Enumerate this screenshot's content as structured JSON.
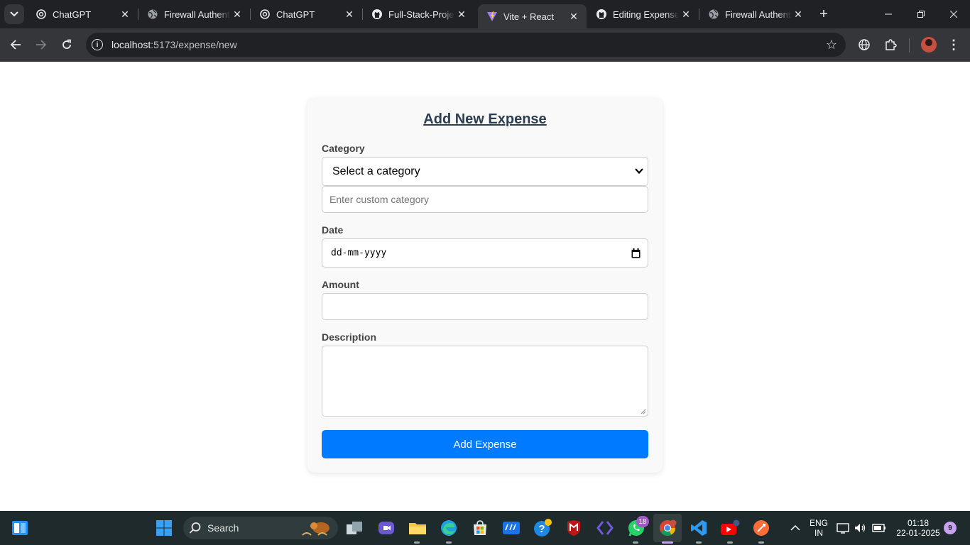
{
  "browser": {
    "tabs": [
      {
        "title": "ChatGPT",
        "icon": "chatgpt-icon",
        "active": false
      },
      {
        "title": "Firewall Authentication",
        "icon": "globe-icon",
        "active": false
      },
      {
        "title": "ChatGPT",
        "icon": "chatgpt-icon",
        "active": false
      },
      {
        "title": "Full-Stack-Project",
        "icon": "github-icon",
        "active": false
      },
      {
        "title": "Vite + React",
        "icon": "vite-icon",
        "active": true
      },
      {
        "title": "Editing Expense",
        "icon": "github-icon",
        "active": false
      },
      {
        "title": "Firewall Authentication",
        "icon": "globe-icon",
        "active": false
      }
    ],
    "address": {
      "host": "localhost",
      "path": ":5173/expense/new"
    }
  },
  "form": {
    "title": "Add New Expense",
    "category": {
      "label": "Category",
      "selected": "Select a category",
      "custom_placeholder": "Enter custom category"
    },
    "date": {
      "label": "Date",
      "placeholder": "dd-mm-yyyy"
    },
    "amount": {
      "label": "Amount",
      "value": ""
    },
    "description": {
      "label": "Description",
      "value": ""
    },
    "submit_label": "Add Expense"
  },
  "taskbar": {
    "search_label": "Search",
    "whatsapp_badge": "18",
    "notification_badge": "9",
    "language": {
      "line1": "ENG",
      "line2": "IN"
    },
    "clock": {
      "time": "01:18",
      "date": "22-01-2025"
    }
  },
  "colors": {
    "accent": "#007bff",
    "title": "#2c3e50",
    "browser_frame": "#202124",
    "toolbar": "#35363a",
    "taskbar": "#1f2a2c"
  }
}
